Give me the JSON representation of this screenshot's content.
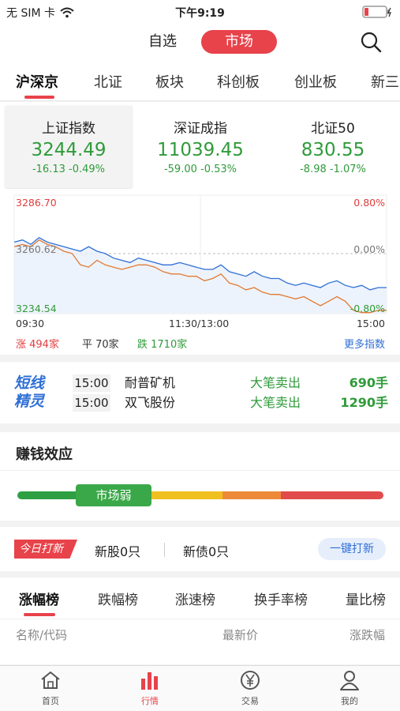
{
  "status_bar": {
    "carrier": "无 SIM 卡",
    "time": "下午9:19"
  },
  "header": {
    "seg_left": "自选",
    "seg_right": "市场"
  },
  "market_tabs": [
    "沪深京",
    "北证",
    "板块",
    "科创板",
    "创业板",
    "新三"
  ],
  "indices": [
    {
      "name": "上证指数",
      "value": "3244.49",
      "change": "-16.13",
      "pct": "-0.49%"
    },
    {
      "name": "深证成指",
      "value": "11039.45",
      "change": "-59.00",
      "pct": "-0.53%"
    },
    {
      "name": "北证50",
      "value": "830.55",
      "change": "-8.98",
      "pct": "-1.07%"
    }
  ],
  "chart_data": {
    "type": "line",
    "y_labels": {
      "top": "3286.70",
      "mid": "3260.62",
      "bottom": "3234.54"
    },
    "pct_labels": {
      "top": "0.80%",
      "mid": "0.00%",
      "bottom": "-0.80%"
    },
    "x_labels": [
      "09:30",
      "11:30/13:00",
      "15:00"
    ],
    "ylim": [
      3234.54,
      3286.7
    ],
    "series": [
      {
        "color": "#2f6fd6",
        "values": [
          3266,
          3267,
          3265,
          3268,
          3266,
          3265,
          3264,
          3263,
          3262,
          3264,
          3262,
          3261,
          3259,
          3258,
          3257,
          3259,
          3258,
          3257,
          3256,
          3256,
          3257,
          3256,
          3255,
          3254,
          3254,
          3256,
          3253,
          3252,
          3251,
          3253,
          3251,
          3250,
          3250,
          3248,
          3247,
          3248,
          3247,
          3246,
          3248,
          3249,
          3247,
          3246,
          3247,
          3245,
          3246,
          3246
        ]
      },
      {
        "color": "#e27a33",
        "values": [
          3264,
          3265,
          3264,
          3267,
          3265,
          3264,
          3262,
          3261,
          3256,
          3255,
          3258,
          3256,
          3255,
          3254,
          3255,
          3256,
          3256,
          3255,
          3253,
          3252,
          3252,
          3251,
          3251,
          3249,
          3250,
          3252,
          3248,
          3247,
          3245,
          3246,
          3244,
          3243,
          3243,
          3242,
          3241,
          3242,
          3240,
          3238,
          3240,
          3242,
          3240,
          3236,
          3235,
          3235,
          3236,
          3236
        ]
      }
    ]
  },
  "breadth": {
    "up": "涨 494家",
    "flat": "平 70家",
    "down": "跌 1710家",
    "more": "更多指数"
  },
  "sprite": {
    "logo_line1": "短线",
    "logo_line2": "精灵",
    "rows": [
      {
        "time": "15:00",
        "name": "耐普矿机",
        "action": "大笔卖出",
        "value": "690手"
      },
      {
        "time": "15:00",
        "name": "双飞股份",
        "action": "大笔卖出",
        "value": "1290手"
      }
    ]
  },
  "effect": {
    "title": "赚钱效应",
    "marker": "市场弱",
    "level": 0.2,
    "colors": [
      "#2ea043",
      "#f0c020",
      "#ec8a3a",
      "#e24b4b"
    ]
  },
  "ipo": {
    "tag": "今日打新",
    "stocks": "新股0只",
    "bonds": "新债0只",
    "button": "一键打新"
  },
  "ranking": {
    "tabs": [
      "涨幅榜",
      "跌幅榜",
      "涨速榜",
      "换手率榜",
      "量比榜"
    ],
    "columns": [
      "名称/代码",
      "最新价",
      "涨跌幅"
    ]
  },
  "bottom_nav": [
    {
      "label": "首页",
      "icon": "home-icon"
    },
    {
      "label": "行情",
      "icon": "bar-chart-icon"
    },
    {
      "label": "交易",
      "icon": "yen-icon"
    },
    {
      "label": "我的",
      "icon": "person-icon"
    }
  ],
  "colors": {
    "accent": "#e8424a",
    "up": "#e23c3c",
    "down": "#2f9b3a",
    "link": "#2f6fd6"
  }
}
